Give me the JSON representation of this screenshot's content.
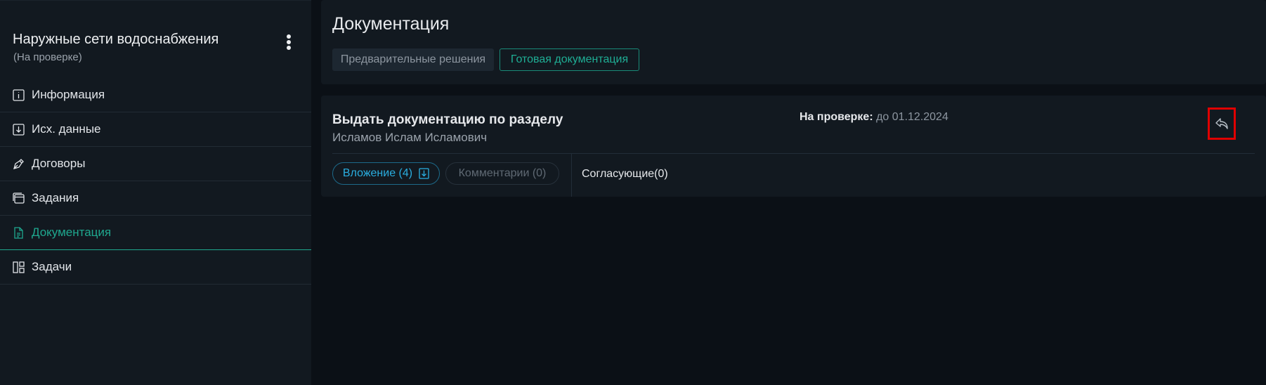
{
  "sidebar": {
    "title": "Наружные сети водоснабжения",
    "subtitle": "(На проверке)",
    "items": [
      {
        "label": "Информация",
        "icon": "info-icon"
      },
      {
        "label": "Исх. данные",
        "icon": "download-box-icon"
      },
      {
        "label": "Договоры",
        "icon": "pen-icon"
      },
      {
        "label": "Задания",
        "icon": "window-stack-icon"
      },
      {
        "label": "Документация",
        "icon": "document-icon",
        "active": true
      },
      {
        "label": "Задачи",
        "icon": "board-icon"
      }
    ]
  },
  "header": {
    "title": "Документация",
    "tabs": [
      {
        "label": "Предварительные решения"
      },
      {
        "label": "Готовая документация",
        "active": true
      }
    ]
  },
  "card": {
    "title": "Выдать документацию по разделу",
    "assignee": "Исламов Ислам Исламович",
    "status_label": "На проверке:",
    "status_value": "до 01.12.2024",
    "attachments_label": "Вложение (4)",
    "comments_label": "Комментарии (0)",
    "approvers_label": "Согласующие(0)"
  },
  "colors": {
    "accent": "#1fa88f",
    "link": "#2aaee0",
    "highlight": "#e00000"
  }
}
